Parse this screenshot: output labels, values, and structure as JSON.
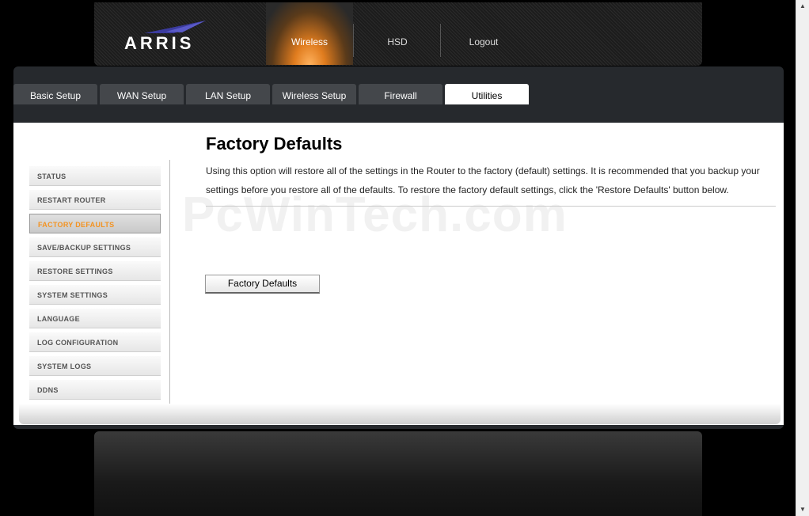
{
  "brand": {
    "name": "ARRIS"
  },
  "topnav": [
    {
      "label": "Wireless",
      "active": true
    },
    {
      "label": "HSD",
      "active": false
    },
    {
      "label": "Logout",
      "active": false
    }
  ],
  "tabs": [
    {
      "label": "Basic Setup"
    },
    {
      "label": "WAN Setup"
    },
    {
      "label": "LAN Setup"
    },
    {
      "label": "Wireless Setup"
    },
    {
      "label": "Firewall"
    },
    {
      "label": "Utilities"
    }
  ],
  "sidebar": {
    "items": [
      {
        "label": "STATUS"
      },
      {
        "label": "RESTART ROUTER"
      },
      {
        "label": "FACTORY DEFAULTS"
      },
      {
        "label": "SAVE/BACKUP SETTINGS"
      },
      {
        "label": "RESTORE SETTINGS"
      },
      {
        "label": "SYSTEM SETTINGS"
      },
      {
        "label": "LANGUAGE"
      },
      {
        "label": "LOG CONFIGURATION"
      },
      {
        "label": "SYSTEM LOGS"
      },
      {
        "label": "DDNS"
      }
    ]
  },
  "main": {
    "title": "Factory Defaults",
    "description": "Using this option will restore all of the settings in the Router to the factory (default) settings. It is recommended that you backup your settings before you restore all of the defaults. To restore the factory default settings, click the 'Restore Defaults' button below.",
    "button_label": "Factory Defaults"
  },
  "watermark": "PcWinTech.com",
  "colors": {
    "accent": "#f39322",
    "panel": "#26292d"
  }
}
